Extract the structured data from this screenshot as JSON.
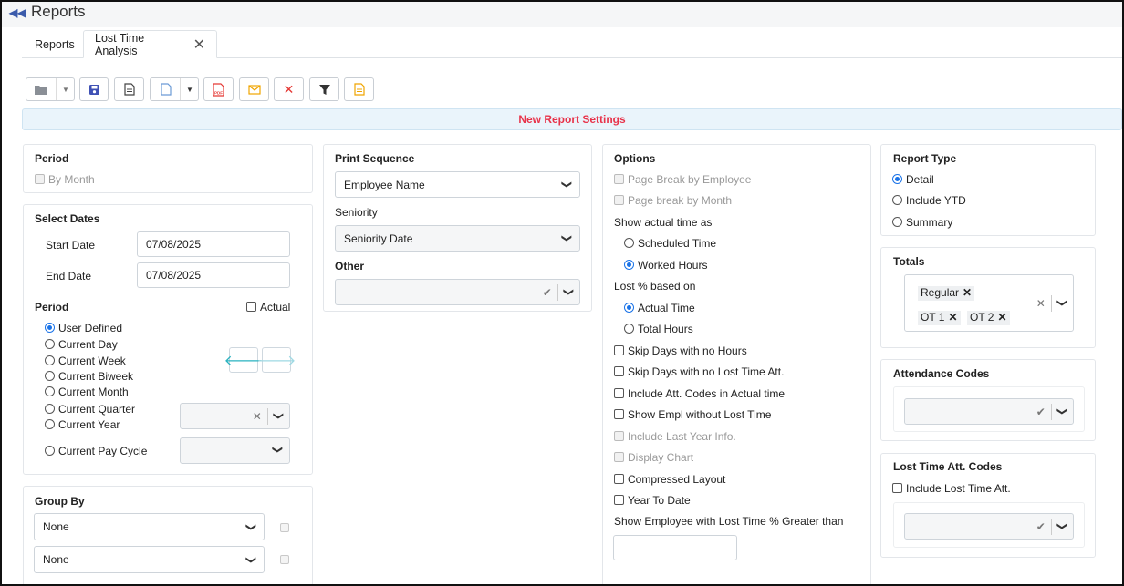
{
  "app": {
    "title": "Reports"
  },
  "tabs": [
    {
      "label": "Reports"
    },
    {
      "label": "Lost Time Analysis"
    }
  ],
  "colors": {
    "accent": "#1a73e8",
    "banner_text": "#e8334a",
    "banner_bg": "#eaf4fb",
    "teal": "#2bb3c0"
  },
  "toolbar": {
    "icons": [
      "folder-icon",
      "save-icon",
      "document-icon",
      "file-icon",
      "pdf-icon",
      "email-icon",
      "delete-icon",
      "filter-icon",
      "notes-icon"
    ],
    "pdf_label": "PDF"
  },
  "banner": {
    "text": "New Report Settings"
  },
  "period_panel": {
    "title": "Period",
    "by_month": "By Month"
  },
  "dates": {
    "title": "Select Dates",
    "start_label": "Start Date",
    "start_value": "07/08/2025",
    "end_label": "End Date",
    "end_value": "07/08/2025",
    "period_title": "Period",
    "actual_label": "Actual",
    "options": [
      "User Defined",
      "Current Day",
      "Current Week",
      "Current Biweek",
      "Current Month",
      "Current Quarter",
      "Current Year",
      "Current Pay Cycle"
    ],
    "selected": "User Defined",
    "prev_arrow": "🡐",
    "next_arrow": "🡒"
  },
  "group_by": {
    "title": "Group By",
    "first": "None",
    "second": "None"
  },
  "print_seq": {
    "title": "Print Sequence",
    "value": "Employee Name",
    "seniority_label": "Seniority",
    "seniority_value": "Seniority Date",
    "other_label": "Other"
  },
  "options": {
    "title": "Options",
    "page_break_employee": "Page Break by Employee",
    "page_break_month": "Page break by Month",
    "show_actual_label": "Show actual time as",
    "scheduled_time": "Scheduled Time",
    "worked_hours": "Worked Hours",
    "lost_pct_label": "Lost % based on",
    "actual_time": "Actual Time",
    "total_hours": "Total Hours",
    "skip_no_hours": "Skip Days with no Hours",
    "skip_no_lost": "Skip Days with no Lost Time Att.",
    "include_att_codes": "Include Att. Codes in Actual time",
    "show_empl_without": "Show Empl without Lost Time",
    "include_last_year": "Include Last Year Info.",
    "display_chart": "Display Chart",
    "compressed_layout": "Compressed Layout",
    "year_to_date": "Year To Date",
    "show_greater_label": "Show Employee with Lost Time % Greater than",
    "greater_value": ""
  },
  "report_type": {
    "title": "Report Type",
    "detail": "Detail",
    "include_ytd": "Include YTD",
    "summary": "Summary",
    "selected": "Detail"
  },
  "totals": {
    "title": "Totals",
    "tags": [
      "Regular",
      "OT 1",
      "OT 2"
    ]
  },
  "attendance": {
    "title": "Attendance Codes"
  },
  "lost_codes": {
    "title": "Lost Time Att. Codes",
    "include_label": "Include Lost Time Att."
  }
}
